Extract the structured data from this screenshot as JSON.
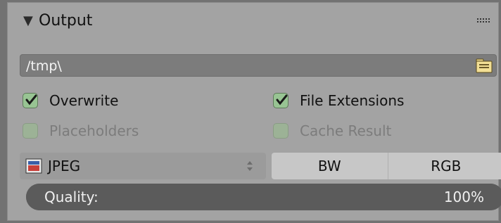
{
  "panel": {
    "title": "Output",
    "output_path": "/tmp\\",
    "options": [
      {
        "label": "Overwrite",
        "checked": true,
        "enabled": true
      },
      {
        "label": "File Extensions",
        "checked": true,
        "enabled": true
      },
      {
        "label": "Placeholders",
        "checked": false,
        "enabled": false
      },
      {
        "label": "Cache Result",
        "checked": false,
        "enabled": false
      }
    ],
    "file_format": "JPEG",
    "color_modes": [
      "BW",
      "RGB"
    ],
    "quality": {
      "label": "Quality:",
      "value_text": "100%",
      "value": 100
    }
  }
}
